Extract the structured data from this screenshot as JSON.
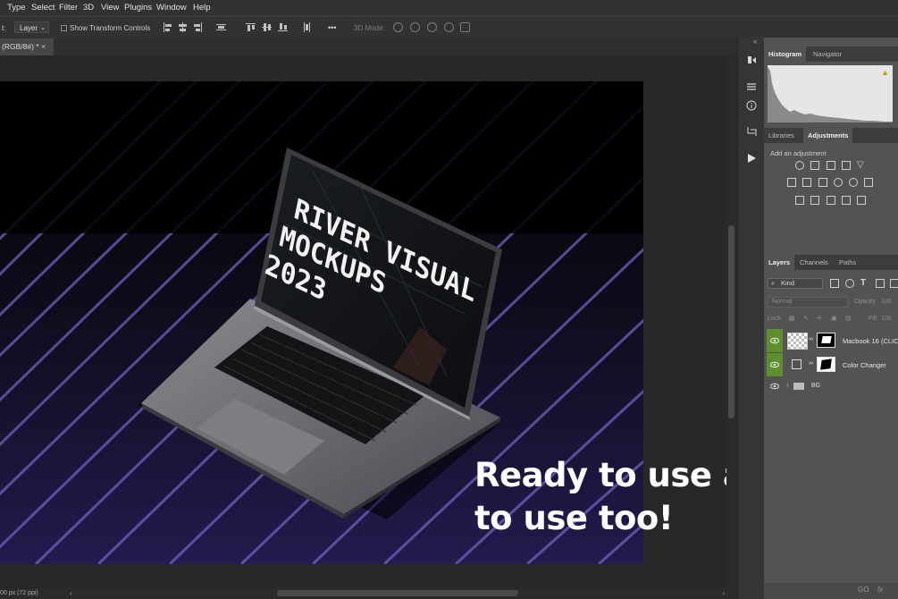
{
  "menu": [
    "Type",
    "Select",
    "Filter",
    "3D",
    "View",
    "Plugins",
    "Window",
    "Help"
  ],
  "options": {
    "prefix": "t:",
    "target": "Layer",
    "show_transform": "Show Transform Controls",
    "more": "•••",
    "mode3d": "3D Mode:"
  },
  "document": {
    "tab": "(RGB/8#) *",
    "close": "×"
  },
  "status": {
    "text": "00 px (72 ppi)"
  },
  "screen": {
    "lines": [
      "RIVER VISUAL",
      "MOCKUPS",
      "2023"
    ]
  },
  "overlay": {
    "line1": "Ready to use and easy",
    "line2": "to use too!"
  },
  "panels": {
    "tabs_top": [
      "Histogram",
      "Navigator"
    ],
    "tabs_mid": [
      "Libraries",
      "Adjustments"
    ],
    "add_adjustment": "Add an adjustment",
    "tabs_layers": [
      "Layers",
      "Channels",
      "Paths"
    ],
    "kind": "Kind",
    "blend": "Normal",
    "opacity_label": "Opacity:",
    "opacity": "100",
    "lock_label": "Lock:",
    "fill_label": "Fill:",
    "fill": "100",
    "layers": [
      {
        "name": "Macbook 16 (CLIC"
      },
      {
        "name": "Color Changer"
      },
      {
        "name": "BG"
      }
    ],
    "collapse": "«",
    "bottom_icons": [
      "GO",
      "fx"
    ]
  },
  "colors": {
    "accent_eye": "#5e8f2f",
    "stripe": "#6c5cc8"
  }
}
